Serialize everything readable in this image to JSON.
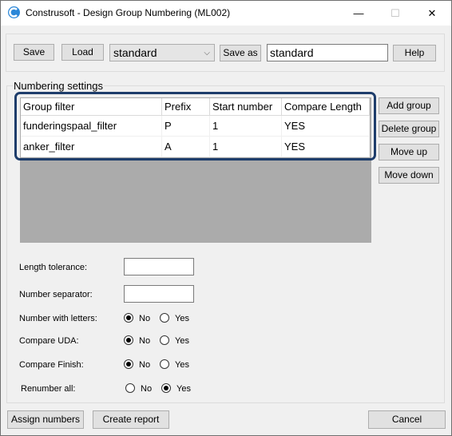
{
  "window": {
    "title": "Construsoft - Design Group Numbering (ML002)",
    "min_glyph": "—",
    "max_glyph": "☐",
    "close_glyph": "✕"
  },
  "toolbar": {
    "save_label": "Save",
    "load_label": "Load",
    "preset_value": "standard",
    "save_as_label": "Save as",
    "save_as_value": "standard",
    "help_label": "Help"
  },
  "numbering": {
    "title": "Numbering settings",
    "columns": [
      "Group filter",
      "Prefix",
      "Start number",
      "Compare Length"
    ],
    "rows": [
      [
        "funderingspaal_filter",
        "P",
        "1",
        "YES"
      ],
      [
        "anker_filter",
        "A",
        "1",
        "YES"
      ]
    ],
    "add_group_label": "Add group",
    "delete_group_label": "Delete group",
    "move_up_label": "Move up",
    "move_down_label": "Move down"
  },
  "fields": {
    "length_tolerance_label": "Length tolerance:",
    "length_tolerance_value": "",
    "number_separator_label": "Number separator:",
    "number_separator_value": "",
    "number_with_letters_label": "Number with letters:",
    "compare_uda_label": "Compare UDA:",
    "compare_finish_label": "Compare Finish:",
    "renumber_all_label": "Renumber all:",
    "no_label": "No",
    "yes_label": "Yes"
  },
  "footer": {
    "assign_label": "Assign numbers",
    "report_label": "Create report",
    "cancel_label": "Cancel"
  }
}
